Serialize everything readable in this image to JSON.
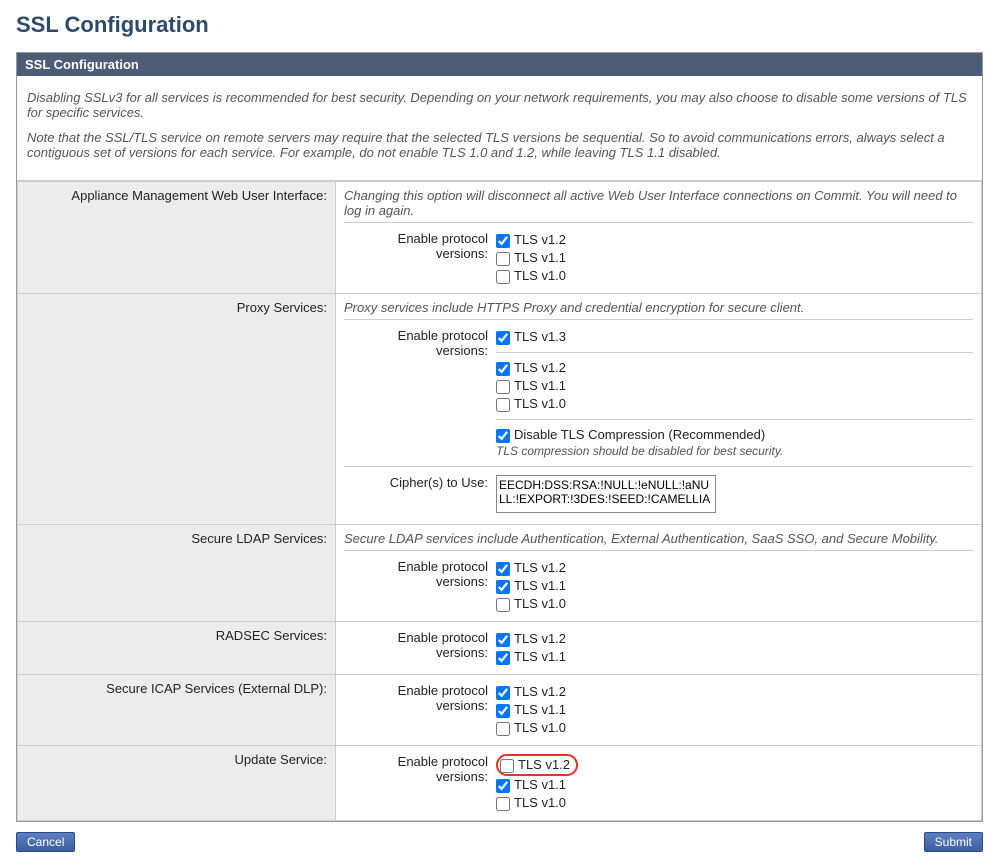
{
  "page_title": "SSL Configuration",
  "panel_title": "SSL Configuration",
  "intro": {
    "p1": "Disabling SSLv3 for all services is recommended for best security. Depending on your network requirements, you may also choose to disable some versions of TLS for specific services.",
    "p2": "Note that the SSL/TLS service on remote servers may require that the selected TLS versions be sequential. So to avoid communications errors, always select a contiguous set of versions for each service. For example, do not enable TLS 1.0 and 1.2, while leaving TLS 1.1 disabled."
  },
  "enable_label": "Enable protocol versions:",
  "cipher_label": "Cipher(s) to Use:",
  "sections": {
    "webui": {
      "label": "Appliance Management Web User Interface:",
      "note": "Changing this option will disconnect all active Web User Interface connections on Commit. You will need to log in again.",
      "versions": [
        {
          "label": "TLS v1.2",
          "checked": true
        },
        {
          "label": "TLS v1.1",
          "checked": false
        },
        {
          "label": "TLS v1.0",
          "checked": false
        }
      ]
    },
    "proxy": {
      "label": "Proxy Services:",
      "note": "Proxy services include HTTPS Proxy and credential encryption for secure client.",
      "versions": [
        {
          "label": "TLS v1.3",
          "checked": true
        },
        {
          "label": "TLS v1.2",
          "checked": true
        },
        {
          "label": "TLS v1.1",
          "checked": false
        },
        {
          "label": "TLS v1.0",
          "checked": false
        }
      ],
      "compression": {
        "label": "Disable TLS Compression (Recommended)",
        "checked": true,
        "hint": "TLS compression should be disabled for best security."
      },
      "cipher_value": "EECDH:DSS:RSA:!NULL:!eNULL:!aNULL:!EXPORT:!3DES:!SEED:!CAMELLIA"
    },
    "ldap": {
      "label": "Secure LDAP Services:",
      "note": "Secure LDAP services include Authentication, External Authentication, SaaS SSO, and Secure Mobility.",
      "versions": [
        {
          "label": "TLS v1.2",
          "checked": true
        },
        {
          "label": "TLS v1.1",
          "checked": true
        },
        {
          "label": "TLS v1.0",
          "checked": false
        }
      ]
    },
    "radsec": {
      "label": "RADSEC Services:",
      "versions": [
        {
          "label": "TLS v1.2",
          "checked": true
        },
        {
          "label": "TLS v1.1",
          "checked": true
        }
      ]
    },
    "icap": {
      "label": "Secure ICAP Services (External DLP):",
      "versions": [
        {
          "label": "TLS v1.2",
          "checked": true
        },
        {
          "label": "TLS v1.1",
          "checked": true
        },
        {
          "label": "TLS v1.0",
          "checked": false
        }
      ]
    },
    "update": {
      "label": "Update Service:",
      "versions": [
        {
          "label": "TLS v1.2",
          "checked": false,
          "highlight": true
        },
        {
          "label": "TLS v1.1",
          "checked": true
        },
        {
          "label": "TLS v1.0",
          "checked": false
        }
      ]
    }
  },
  "buttons": {
    "cancel": "Cancel",
    "submit": "Submit"
  }
}
